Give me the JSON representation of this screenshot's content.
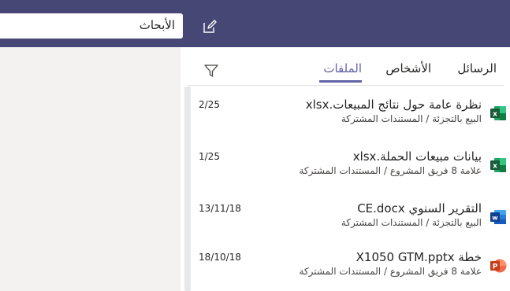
{
  "search": {
    "value": "الأبحاث"
  },
  "tabs": [
    {
      "label": "الرسائل",
      "active": false
    },
    {
      "label": "الأشخاص",
      "active": false
    },
    {
      "label": "الملفات",
      "active": true
    }
  ],
  "files": [
    {
      "title": "نظرة عامة حول نتائج المبيعات.xlsx",
      "path": "البيع بالتجزئة / المستندات المشتركة",
      "date": "2/25",
      "icon": "excel-icon"
    },
    {
      "title": "بيانات مبيعات الحملة.xlsx",
      "path": "علامة 8 فريق المشروع / المستندات المشتركة",
      "date": "1/25",
      "icon": "excel-icon"
    },
    {
      "title": "التقرير السنوي CE.docx",
      "path": "البيع بالتجزئة / المستندات المشتركة",
      "date": "13/11/18",
      "icon": "word-icon"
    },
    {
      "title": "خطة X1050 GTM.pptx",
      "path": "علامة 8 فريق المشروع / المستندات المشتركة",
      "date": "18/10/18",
      "icon": "powerpoint-icon"
    }
  ],
  "colors": {
    "header": "#464775",
    "accent": "#6264a7",
    "excel": "#217346",
    "word": "#2b579a",
    "powerpoint": "#d24726"
  }
}
